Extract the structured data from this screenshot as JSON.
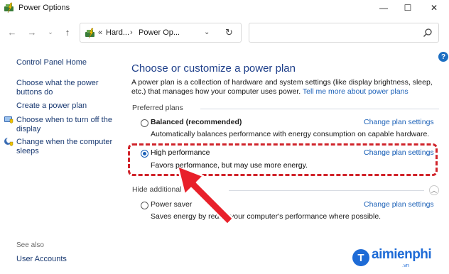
{
  "window": {
    "title": "Power Options",
    "minimize_glyph": "—",
    "maximize_glyph": "☐",
    "close_glyph": "✕"
  },
  "navigation": {
    "back_glyph": "←",
    "forward_glyph": "→",
    "history_glyph": "⌄",
    "up_glyph": "↑"
  },
  "address": {
    "prefix": "«",
    "crumbs": [
      "Hard...",
      "Power Op..."
    ],
    "separator": "›",
    "dropdown_glyph": "⌄",
    "refresh_glyph": "↻"
  },
  "search": {
    "placeholder": ""
  },
  "left_pane": {
    "home_link": "Control Panel Home",
    "links": [
      {
        "label": "Choose what the power buttons do",
        "icon": ""
      },
      {
        "label": "Create a power plan",
        "icon": ""
      },
      {
        "label": "Choose when to turn off the display",
        "icon": "monitor-shield-icon"
      },
      {
        "label": "Change when the computer sleeps",
        "icon": "moon-shield-icon"
      }
    ],
    "see_also_label": "See also",
    "see_also_links": [
      "User Accounts"
    ]
  },
  "main": {
    "help_glyph": "?",
    "heading": "Choose or customize a power plan",
    "description": "A power plan is a collection of hardware and system settings (like display brightness, sleep, etc.) that manages how your computer uses power.",
    "description_link": "Tell me more about power plans",
    "preferred_section": "Preferred plans",
    "plans": [
      {
        "name": "Balanced (recommended)",
        "description": "Automatically balances performance with energy consumption on capable hardware.",
        "link": "Change plan settings",
        "selected": false
      },
      {
        "name": "High performance",
        "description": "Favors performance, but may use more energy.",
        "link": "Change plan settings",
        "selected": true
      }
    ],
    "hidden_section": "Hide additional plans",
    "hidden_section_display": "Hide additional p",
    "hidden_plans": [
      {
        "name": "Power saver",
        "description": "Saves energy by reducing your computer's performance where possible.",
        "description_left": "Saves energy by redu",
        "description_right": "your computer's performance where possible.",
        "link": "Change plan settings",
        "selected": false
      }
    ],
    "collapse_glyph": "︿"
  },
  "colors": {
    "heading": "#1e3f8a",
    "link": "#1d62b8",
    "highlight_border": "#d0232a",
    "arrow": "#e8202a"
  },
  "watermark": {
    "logo_letter": "T",
    "text": "aimienphi",
    "subtext": ".vn"
  }
}
